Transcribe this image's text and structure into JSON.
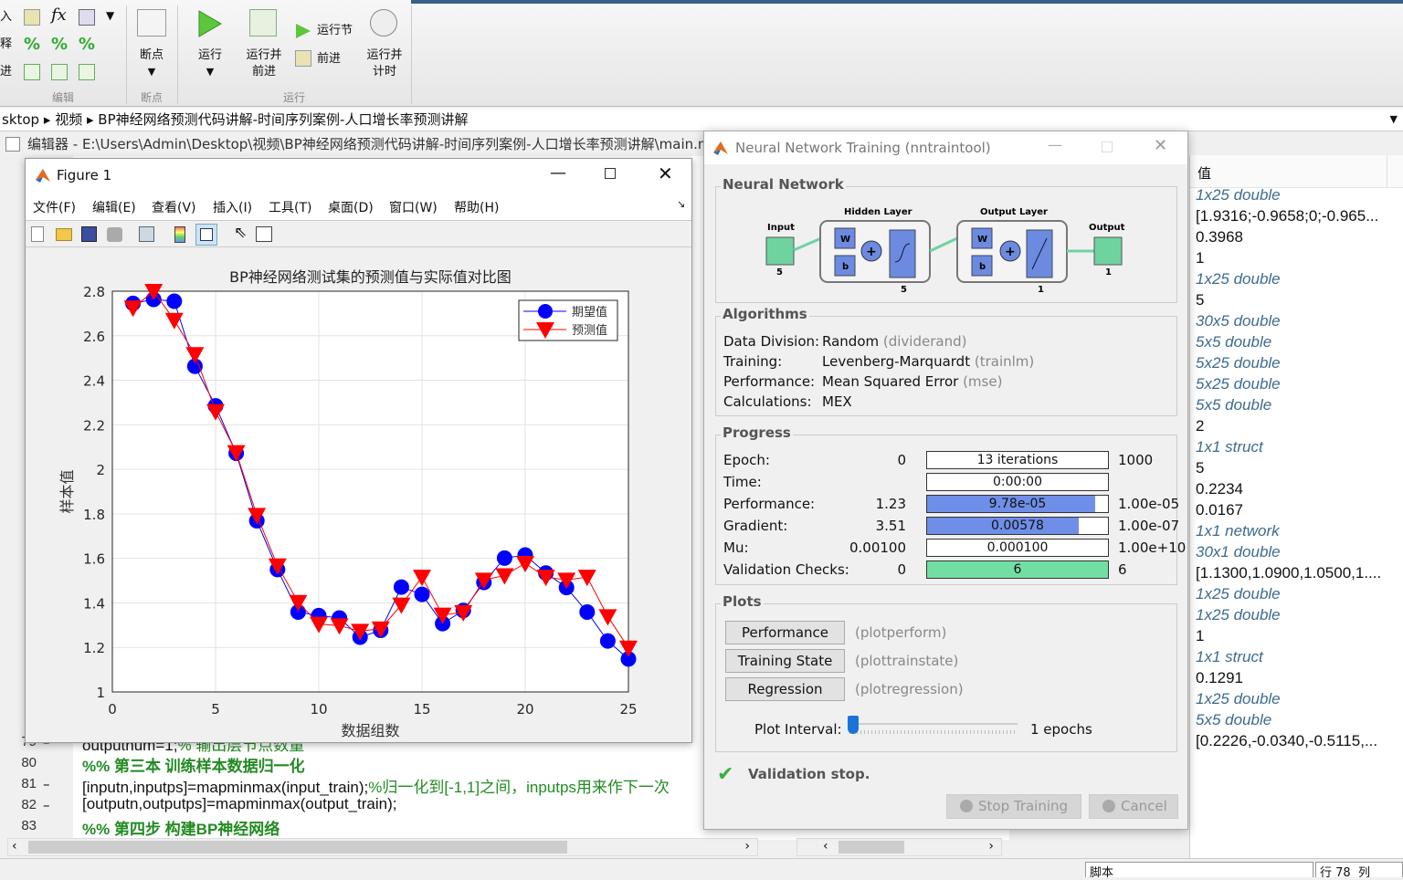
{
  "ribbon": {
    "edit_rows": [
      "入",
      "释",
      "进"
    ],
    "groups": [
      "编辑",
      "断点",
      "运行"
    ],
    "breakpoint": "断点",
    "run": "运行",
    "run_advance": [
      "运行并",
      "前进"
    ],
    "run_section": "运行节",
    "advance": "前进",
    "run_time": [
      "运行并",
      "计时"
    ]
  },
  "address": {
    "path": [
      "sktop",
      "视频",
      "BP神经网络预测代码讲解-时间序列案例-人口增长率预测讲解"
    ]
  },
  "editor": {
    "title": "编辑器 - E:\\Users\\Admin\\Desktop\\视频\\BP神经网络预测代码讲解-时间序列案例-人口增长率预测讲解\\main.m",
    "lines": [
      {
        "num": "79",
        "marker": "–",
        "code": "outputnum=1;",
        "comment": "% 输出层节点数量"
      },
      {
        "num": "80",
        "marker": "",
        "code": "",
        "comment": "%% 第三本 训练样本数据归一化"
      },
      {
        "num": "81",
        "marker": "–",
        "code": "[inputn,inputps]=mapminmax(input_train);",
        "comment": "%归一化到[-1,1]之间，inputps用来作下一次"
      },
      {
        "num": "82",
        "marker": "–",
        "code": "[outputn,outputps]=mapminmax(output_train);",
        "comment": ""
      },
      {
        "num": "83",
        "marker": "",
        "code": "",
        "comment": "%% 第四步 构建BP神经网络"
      }
    ]
  },
  "figure": {
    "title": "Figure 1",
    "menu": [
      "文件(F)",
      "编辑(E)",
      "查看(V)",
      "插入(I)",
      "工具(T)",
      "桌面(D)",
      "窗口(W)",
      "帮助(H)"
    ]
  },
  "chart_data": {
    "type": "line",
    "title": "BP神经网络测试集的预测值与实际值对比图",
    "xlabel": "数据组数",
    "ylabel": "样本值",
    "xlim": [
      0,
      25
    ],
    "ylim": [
      1,
      2.8
    ],
    "xticks": [
      "0",
      "5",
      "10",
      "15",
      "20",
      "25"
    ],
    "yticks": [
      "1",
      "1.2",
      "1.4",
      "1.6",
      "1.8",
      "2",
      "2.2",
      "2.4",
      "2.6",
      "2.8"
    ],
    "grid": true,
    "legend_position": "top-right",
    "x": [
      1,
      2,
      3,
      4,
      5,
      6,
      7,
      8,
      9,
      10,
      11,
      12,
      13,
      14,
      15,
      16,
      17,
      18,
      19,
      20,
      21,
      22,
      23,
      24,
      25
    ],
    "series": [
      {
        "name": "期望值",
        "color": "#0000ff",
        "marker": "circle",
        "values": [
          2.745,
          2.763,
          2.755,
          2.463,
          2.285,
          2.072,
          1.769,
          1.55,
          1.359,
          1.343,
          1.332,
          1.246,
          1.277,
          1.471,
          1.438,
          1.307,
          1.366,
          1.492,
          1.601,
          1.615,
          1.534,
          1.469,
          1.359,
          1.229,
          1.148
        ]
      },
      {
        "name": "预测值",
        "color": "#ff0000",
        "marker": "triangle-down",
        "values": [
          2.725,
          2.8,
          2.67,
          2.516,
          2.26,
          2.076,
          1.794,
          1.567,
          1.403,
          1.305,
          1.298,
          1.273,
          1.284,
          1.391,
          1.516,
          1.346,
          1.357,
          1.503,
          1.523,
          1.578,
          1.516,
          1.503,
          1.516,
          1.339,
          1.198
        ]
      }
    ]
  },
  "nntool": {
    "title": "Neural Network Training (nntraintool)",
    "network": {
      "title": "Neural Network",
      "input": "Input",
      "input_size": "5",
      "hidden": "Hidden Layer",
      "hidden_size": "5",
      "outlayer": "Output Layer",
      "out_size": "1",
      "output": "Output",
      "output_size": "1",
      "w": "W",
      "b": "b"
    },
    "algorithms": {
      "title": "Algorithms",
      "rows": [
        {
          "label": "Data Division:",
          "value": "Random",
          "fn": "(dividerand)"
        },
        {
          "label": "Training:",
          "value": "Levenberg-Marquardt",
          "fn": "(trainlm)"
        },
        {
          "label": "Performance:",
          "value": "Mean Squared Error",
          "fn": "(mse)"
        },
        {
          "label": "Calculations:",
          "value": "MEX",
          "fn": ""
        }
      ]
    },
    "progress": {
      "title": "Progress",
      "rows": [
        {
          "label": "Epoch:",
          "start": "0",
          "current": "13 iterations",
          "end": "1000",
          "fill": 0,
          "color": "#6f8ee8"
        },
        {
          "label": "Time:",
          "start": "",
          "current": "0:00:00",
          "end": "",
          "fill": 0,
          "color": "#6f8ee8"
        },
        {
          "label": "Performance:",
          "start": "1.23",
          "current": "9.78e-05",
          "end": "1.00e-05",
          "fill": 0.93,
          "color": "#6f8ee8"
        },
        {
          "label": "Gradient:",
          "start": "3.51",
          "current": "0.00578",
          "end": "1.00e-07",
          "fill": 0.84,
          "color": "#6f8ee8"
        },
        {
          "label": "Mu:",
          "start": "0.00100",
          "current": "0.000100",
          "end": "1.00e+10",
          "fill": 0,
          "color": "#6f8ee8"
        },
        {
          "label": "Validation Checks:",
          "start": "0",
          "current": "6",
          "end": "6",
          "fill": 1,
          "color": "#73dea4"
        }
      ]
    },
    "plots": {
      "title": "Plots",
      "buttons": [
        {
          "label": "Performance",
          "fn": "(plotperform)"
        },
        {
          "label": "Training State",
          "fn": "(plottrainstate)"
        },
        {
          "label": "Regression",
          "fn": "(plotregression)"
        }
      ],
      "interval_label": "Plot Interval:",
      "interval_value": "1 epochs",
      "interval_fraction": 0
    },
    "status": "Validation stop.",
    "stop": "Stop Training",
    "cancel": "Cancel"
  },
  "workspace": {
    "header": "值",
    "values": [
      {
        "v": "1x25 double",
        "i": true
      },
      {
        "v": "[1.9316;-0.9658;0;-0.965...",
        "i": false
      },
      {
        "v": "0.3968",
        "i": false
      },
      {
        "v": "1",
        "i": false
      },
      {
        "v": "1x25 double",
        "i": true
      },
      {
        "v": "5",
        "i": false
      },
      {
        "v": "30x5 double",
        "i": true
      },
      {
        "v": "5x5 double",
        "i": true
      },
      {
        "v": "5x25 double",
        "i": true
      },
      {
        "v": "5x25 double",
        "i": true
      },
      {
        "v": "5x5 double",
        "i": true
      },
      {
        "v": "2",
        "i": false
      },
      {
        "v": "1x1 struct",
        "i": true
      },
      {
        "v": "5",
        "i": false
      },
      {
        "v": "0.2234",
        "i": false
      },
      {
        "v": "0.0167",
        "i": false
      },
      {
        "v": "1x1 network",
        "i": true
      },
      {
        "v": "30x1 double",
        "i": true
      },
      {
        "v": "[1.1300,1.0900,1.0500,1....",
        "i": false
      },
      {
        "v": "1x25 double",
        "i": true
      },
      {
        "v": "1x25 double",
        "i": true
      },
      {
        "v": "1",
        "i": false
      },
      {
        "v": "1x1 struct",
        "i": true
      },
      {
        "v": "0.1291",
        "i": false
      },
      {
        "v": "1x25 double",
        "i": true
      },
      {
        "v": "5x5 double",
        "i": true
      },
      {
        "v": "[0.2226,-0.0340,-0.5115,...",
        "i": false
      }
    ]
  },
  "statusbar": {
    "mode": "脚本",
    "row_label": "行",
    "row": "78",
    "col_label": "列"
  }
}
